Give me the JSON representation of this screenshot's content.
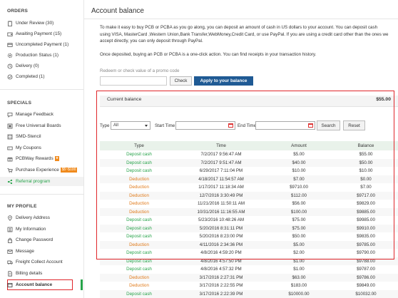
{
  "sidebar": {
    "orders_title": "ORDERS",
    "orders": [
      {
        "label": "Under Review (30)",
        "icon": "clipboard-icon"
      },
      {
        "label": "Awaiting Payment (15)",
        "icon": "wallet-icon"
      },
      {
        "label": "Uncompleted Payment (1)",
        "icon": "credit-card-icon"
      },
      {
        "label": "Production Status (1)",
        "icon": "gear-icon"
      },
      {
        "label": "Delivery (0)",
        "icon": "truck-icon"
      },
      {
        "label": "Completed (1)",
        "icon": "check-circle-icon"
      }
    ],
    "specials_title": "SPECIALS",
    "specials": [
      {
        "label": "Manage Feedback",
        "icon": "comment-icon"
      },
      {
        "label": "Free Universal Boards",
        "icon": "board-icon"
      },
      {
        "label": "SMD-Stencil",
        "icon": "stencil-icon"
      },
      {
        "label": "My Coupons",
        "icon": "coupon-icon"
      },
      {
        "label": "PCBWay Rewards",
        "icon": "gift-icon"
      },
      {
        "label": "Purchase Experience",
        "icon": "cart-icon",
        "badge": "$5~$100"
      },
      {
        "label": "Referral program",
        "icon": "share-icon"
      }
    ],
    "profile_title": "MY PROFILE",
    "profile": [
      {
        "label": "Delivery Address",
        "icon": "location-icon"
      },
      {
        "label": "My Information",
        "icon": "user-icon"
      },
      {
        "label": "Change Password",
        "icon": "lock-icon"
      },
      {
        "label": "Message",
        "icon": "envelope-icon"
      },
      {
        "label": "Freight Collect Account",
        "icon": "freight-icon"
      },
      {
        "label": "Billing details",
        "icon": "document-icon"
      },
      {
        "label": "Account balance",
        "icon": "balance-icon"
      }
    ]
  },
  "main": {
    "title": "Account balance",
    "intro": "To make it easy to buy PCB or PCBA as you go along, you can deposit an amount of cash in US dollars to your account. You can deposit cash using VISA, MasterCard ,Western Union,Bank Transfer,WebMoney,Credit Card, or use PayPal. If you are using a credit card other than the ones we accept directly, you can only deposit through PayPal.",
    "intro2": "Once deposited, buying an PCB or PCBA is a one-click action. You can find receipts in your transaction history.",
    "promo_label": "Redeem or check value of a promo code",
    "check_label": "Check",
    "apply_label": "Apply to your balance",
    "current_balance_label": "Current balance",
    "current_balance_value": "$55.00",
    "filter": {
      "type_label": "Type",
      "type_value": "All",
      "start_label": "Start Time",
      "end_label": "End Time",
      "search_label": "Search",
      "reset_label": "Reset"
    },
    "columns": [
      "Type",
      "Time",
      "Amount",
      "Balance"
    ],
    "rows": [
      [
        "Deposit cash",
        "7/2/2017 9:56:47 AM",
        "$5.00",
        "$55.00"
      ],
      [
        "Deposit cash",
        "7/2/2017 9:51:47 AM",
        "$40.00",
        "$50.00"
      ],
      [
        "Deposit cash",
        "6/29/2017 7:11:04 PM",
        "$10.00",
        "$10.00"
      ],
      [
        "Deduction",
        "4/18/2017 11:54:57 AM",
        "$7.00",
        "$0.00"
      ],
      [
        "Deduction",
        "1/17/2017 11:18:34 AM",
        "$9710.00",
        "$7.00"
      ],
      [
        "Deduction",
        "12/7/2016 3:30:49 PM",
        "$112.00",
        "$9717.00"
      ],
      [
        "Deduction",
        "11/21/2016 11:50:11 AM",
        "$56.00",
        "$9829.00"
      ],
      [
        "Deduction",
        "10/31/2016 11:16:55 AM",
        "$100.00",
        "$9885.00"
      ],
      [
        "Deposit cash",
        "5/23/2016 10:48:26 AM",
        "$75.00",
        "$9985.00"
      ],
      [
        "Deposit cash",
        "5/20/2016 8:31:11 PM",
        "$75.00",
        "$9910.00"
      ],
      [
        "Deposit cash",
        "5/20/2016 8:23:00 PM",
        "$50.00",
        "$9835.00"
      ],
      [
        "Deduction",
        "4/11/2016 2:34:36 PM",
        "$5.00",
        "$9785.00"
      ],
      [
        "Deposit cash",
        "4/8/2016 4:59:20 PM",
        "$2.00",
        "$9790.00"
      ],
      [
        "Deposit cash",
        "4/8/2016 4:57:50 PM",
        "$1.00",
        "$9788.00"
      ],
      [
        "Deposit cash",
        "4/8/2016 4:57:32 PM",
        "$1.00",
        "$9787.00"
      ],
      [
        "Deduction",
        "3/17/2016 2:27:31 PM",
        "$63.00",
        "$9786.00"
      ],
      [
        "Deduction",
        "3/17/2016 2:22:55 PM",
        "$183.00",
        "$9849.00"
      ],
      [
        "Deposit cash",
        "3/17/2016 2:22:39 PM",
        "$10000.00",
        "$10032.00"
      ]
    ]
  },
  "colors": {
    "green": "#27a34a",
    "orange": "#e07a1a",
    "button_blue": "#1f5a94",
    "highlight_red": "#e0262b"
  }
}
